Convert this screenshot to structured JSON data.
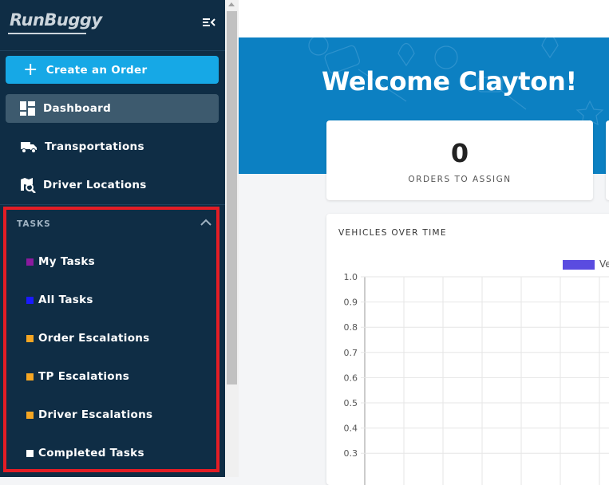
{
  "sidebar": {
    "logo": "RunBuggy",
    "create_order": "Create an Order",
    "nav": [
      {
        "label": "Dashboard",
        "icon": "dashboard-icon"
      },
      {
        "label": "Transportations",
        "icon": "truck-icon"
      },
      {
        "label": "Driver Locations",
        "icon": "map-search-icon"
      }
    ],
    "tasks_header": "TASKS",
    "tasks": [
      {
        "label": "My Tasks",
        "color": "#8b1a9e"
      },
      {
        "label": "All Tasks",
        "color": "#1a1aff"
      },
      {
        "label": "Order Escalations",
        "color": "#f5a623"
      },
      {
        "label": "TP Escalations",
        "color": "#f5a623"
      },
      {
        "label": "Driver Escalations",
        "color": "#f5a623"
      },
      {
        "label": "Completed Tasks",
        "color": "#ffffff"
      }
    ]
  },
  "main": {
    "welcome": "Welcome Clayton!",
    "stat": {
      "value": "0",
      "label": "ORDERS TO ASSIGN"
    },
    "chart_title": "VEHICLES OVER TIME",
    "legend_label": "Ve"
  },
  "chart_data": {
    "type": "line",
    "title": "VEHICLES OVER TIME",
    "series": [
      {
        "name": "Ve",
        "values": []
      }
    ],
    "y_ticks": [
      "1.0",
      "0.9",
      "0.8",
      "0.7",
      "0.6",
      "0.5",
      "0.4",
      "0.3"
    ],
    "ylim": [
      0.3,
      1.0
    ],
    "grid": true,
    "legend": "top-right",
    "color": "#5a4ce0"
  },
  "colors": {
    "sidebar": "#0f2d45",
    "accent": "#16a8e6",
    "banner": "#0c80c2",
    "highlight": "#e41d25"
  }
}
